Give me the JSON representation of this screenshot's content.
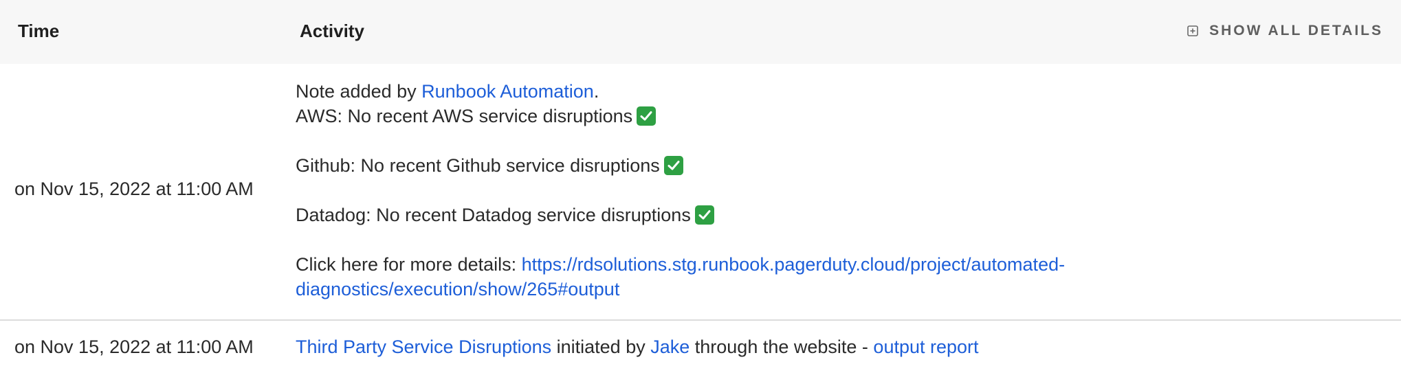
{
  "header": {
    "time_label": "Time",
    "activity_label": "Activity",
    "show_all_label": "SHOW ALL DETAILS",
    "show_all_icon": "expand-square-icon"
  },
  "rows": [
    {
      "time": "on Nov 15, 2022 at 11:00 AM",
      "note_prefix": "Note added by ",
      "note_author": "Runbook Automation",
      "note_suffix": ".",
      "lines": [
        {
          "text": "AWS: No recent AWS service disruptions",
          "icon": "check-mark-icon"
        },
        {
          "text": "Github: No recent Github service disruptions",
          "icon": "check-mark-icon"
        },
        {
          "text": "Datadog: No recent Datadog service disruptions",
          "icon": "check-mark-icon"
        }
      ],
      "details_prefix": "Click here for more details: ",
      "details_url_line1": "https://rdsolutions.stg.runbook.pagerduty.cloud/project/automated-",
      "details_url_line2": "diagnostics/execution/show/265#output"
    },
    {
      "time": "on Nov 15, 2022 at 11:00 AM",
      "job_name": "Third Party Service Disruptions",
      "initiated_text": " initiated by ",
      "user": "Jake",
      "through_text": " through the website - ",
      "report_link": "output report"
    }
  ],
  "colors": {
    "link": "#1d5ed8",
    "header_bg": "#f7f7f7",
    "check_green": "#2ea043"
  }
}
